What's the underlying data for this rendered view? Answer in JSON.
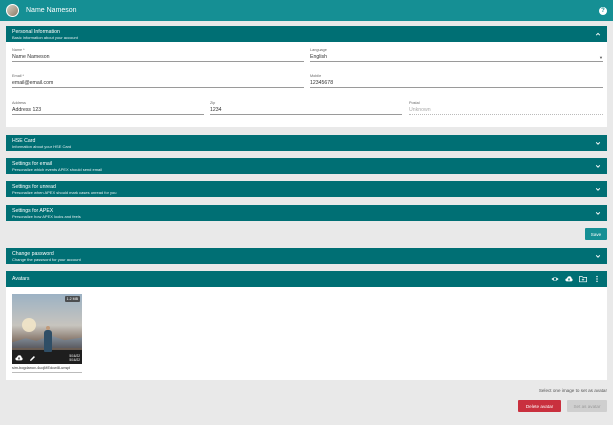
{
  "header": {
    "user_name": "Name Nameson",
    "help_icon": "help-icon"
  },
  "personal": {
    "title": "Personal Information",
    "subtitle": "Basic information about your account",
    "fields": {
      "name": {
        "label": "Name *",
        "value": "Name Nameson"
      },
      "language": {
        "label": "Language",
        "value": "English"
      },
      "email": {
        "label": "Email *",
        "value": "email@email.com"
      },
      "mobile": {
        "label": "Mobile",
        "value": "12345678"
      },
      "address": {
        "label": "Address",
        "value": "Address 123"
      },
      "zip": {
        "label": "Zip",
        "value": "1234"
      },
      "postal": {
        "label": "Postal",
        "value": "Unknown"
      }
    }
  },
  "sections": [
    {
      "title": "HSE Card",
      "subtitle": "Information about your HSE Card"
    },
    {
      "title": "Settings for email",
      "subtitle": "Personalize which events APEX should send email"
    },
    {
      "title": "Settings for unread",
      "subtitle": "Personalize when APEX should mark cases unread for you"
    },
    {
      "title": "Settings for APEX",
      "subtitle": "Personalize how APEX looks and feels"
    },
    {
      "title": "Change password",
      "subtitle": "Change the password for your account"
    }
  ],
  "save_label": "Save",
  "avatars": {
    "title": "Avatars",
    "item": {
      "size": "1.2 MB",
      "date1": "5/16/22",
      "date2": "5/16/22",
      "filename": "sim-bogdanov-4uojMEdcwI8-unspl"
    },
    "hint": "Select one image to set as avatar",
    "delete_label": "Delete avatar",
    "set_label": "Set as avatar"
  },
  "colors": {
    "primary": "#158f94",
    "section": "#006f74",
    "danger": "#c9303e"
  }
}
